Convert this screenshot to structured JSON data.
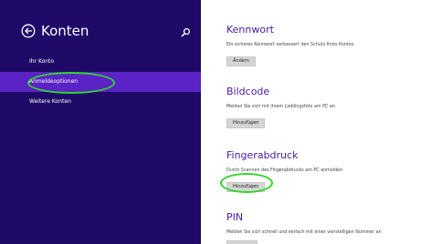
{
  "sidebar": {
    "title": "Konten",
    "items": [
      {
        "label": "Ihr Konto",
        "selected": false
      },
      {
        "label": "Anmeldeoptionen",
        "selected": true
      },
      {
        "label": "Weitere Konten",
        "selected": false
      }
    ]
  },
  "sections": [
    {
      "title": "Kennwort",
      "description": "Ein sicheres Kennwort verbessert den Schutz Ihres Kontos.",
      "button": "Ändern"
    },
    {
      "title": "Bildcode",
      "description": "Melden Sie sich mit Ihrem Lieblingsfoto am PC an",
      "button": "Hinzufügen"
    },
    {
      "title": "Fingerabdruck",
      "description": "Durch Scannen des Fingerabdrucks am PC anmelden",
      "button": "Hinzufügen"
    },
    {
      "title": "PIN",
      "description": "Melden Sie sich schnell und einfach mit einer vierstelligen Nummer an"
    }
  ],
  "colors": {
    "sidebar_bg": "#1f0a68",
    "selected_bg": "#5b22c6",
    "section_title": "#4a1b9a",
    "highlight": "#2fd62b"
  },
  "icons": {
    "back": "back-arrow-circle-icon",
    "search": "search-icon"
  }
}
